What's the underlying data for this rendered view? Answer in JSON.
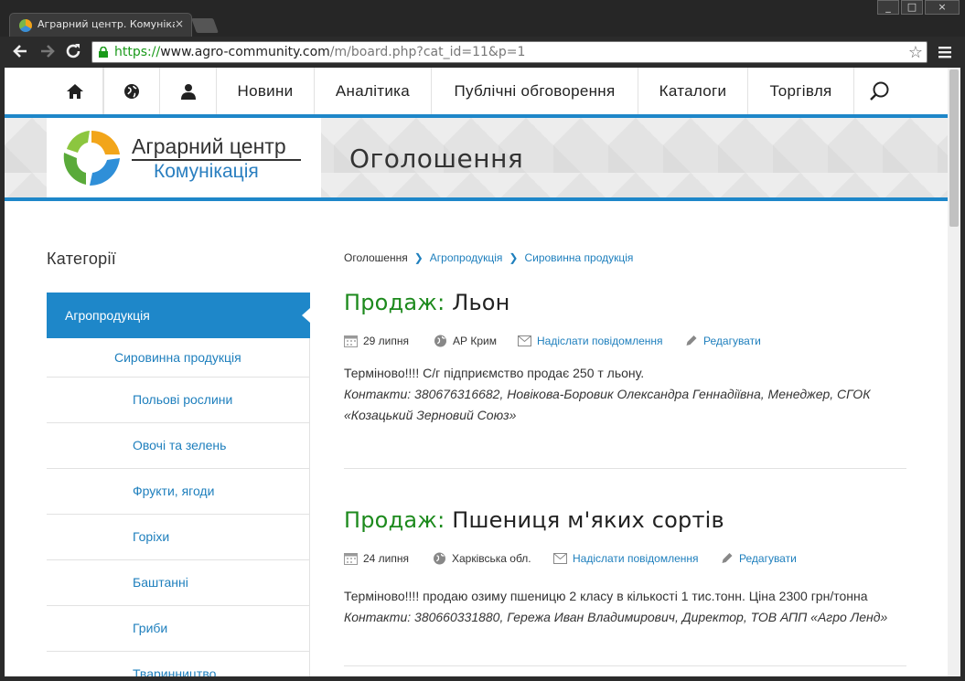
{
  "browser": {
    "tab_title": "Аграрний центр. Комунікаці",
    "tab_close": "×",
    "url_scheme": "https://",
    "url_host": "www.agro-community.com",
    "url_path": "/m/board.php?cat_id=11&p=1",
    "window_min": "_",
    "window_max": "□",
    "window_close": "×"
  },
  "nav": {
    "icons": [
      "home-icon",
      "globe-icon",
      "user-icon"
    ],
    "items": [
      "Новини",
      "Аналітика",
      "Публічні обговорення",
      "Каталоги",
      "Торгівля"
    ],
    "search_icon": "search-icon"
  },
  "banner": {
    "logo_line1": "Аграрний центр",
    "logo_line2": "Комунікація",
    "title": "Оголошення"
  },
  "sidebar": {
    "title": "Категорії",
    "active": "Агропродукція",
    "sub": "Сировинна продукція",
    "items": [
      "Польові рослини",
      "Овочі та зелень",
      "Фрукти, ягоди",
      "Горіхи",
      "Баштанні",
      "Гриби",
      "Тваринництво"
    ]
  },
  "breadcrumb": {
    "root": "Оголошення",
    "level1": "Агропродукція",
    "level2": "Сировинна продукція"
  },
  "listings": [
    {
      "type": "Продаж:",
      "title": " Льон",
      "date": "29 липня",
      "region": "АР Крим",
      "message": "Надіслати повідомлення",
      "edit": "Редагувати",
      "text": "Терміново!!!! С/г підприємство продає 250 т льону.",
      "contacts": "Контакти: 380676316682, Новікова-Боровик Олександра Геннадіївна, Менеджер, СГОК «Козацький Зерновий Союз»"
    },
    {
      "type": "Продаж:",
      "title": " Пшениця м'яких сортів",
      "date": "24 липня",
      "region": "Харківська обл.",
      "message": "Надіслати повідомлення",
      "edit": "Редагувати",
      "text": "Терміново!!!! продаю озиму пшеницю 2 класу в кількості 1 тис.тонн. Ціна 2300 грн/тонна",
      "contacts": "Контакти: 380660331880, Гережа Иван Владимирович, Директор, ТОВ АПП «Агро Ленд»"
    }
  ],
  "colors": {
    "accent": "#1e87c9",
    "sale": "#1d8a1d",
    "link": "#1e7fbd"
  }
}
